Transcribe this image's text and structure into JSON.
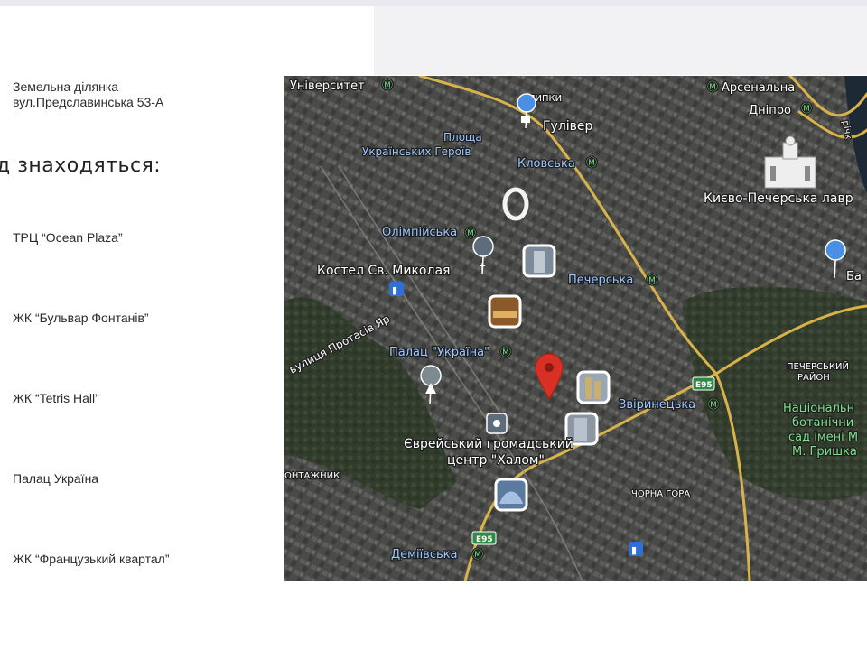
{
  "sidebar": {
    "land_line1": "Земельна ділянка",
    "land_line2": "вул.Предславинська 53-А",
    "heading": "д знаходяться:",
    "items": [
      "ТРЦ “Ocean Plaza”",
      "ЖК “Бульвар Фонтанів”",
      "ЖК “Tetris Hall”",
      "Палац Україна",
      "ЖК “Французький квартал”"
    ]
  },
  "map": {
    "labels": {
      "universytet": "Університет",
      "lypky": "ЛИПКИ",
      "arsenalna": "Арсенальна",
      "dnipro": "Дніпро",
      "ploshcha1": "Площа",
      "ploshcha2": "Українських Героїв",
      "hulliver": "Гулівер",
      "klovska": "Кловська",
      "lavra": "Києво-Печерська лавр",
      "olimpiiska": "Олімпійська",
      "kostel": "Костел Св. Миколая",
      "pecherska": "Печерська",
      "protasiv": "вулиця Протасів Яр",
      "palats": "Палац \"Україна\"",
      "pechersky1": "ПЕЧЕРСЬКИЙ",
      "pechersky2": "РАЙОН",
      "e95a": "E95",
      "zvirynetska": "Звіринецька",
      "botanic1": "Національн",
      "botanic2": "ботанічни",
      "botanic3": "сад імені М",
      "botanic4": "М. Гришка",
      "jewish1": "Єврейський громадський",
      "jewish2": "центр \"Халом\"",
      "montazhnyk": "ОНТАЖНИК",
      "chorna_hora": "ЧОРНА ГОРА",
      "e95b": "E95",
      "demiivska": "Деміївська",
      "river": "річк",
      "ba": "Ба"
    },
    "colors": {
      "road": "#d8b24a",
      "pin": "#d93025",
      "metro": "#3fb24f",
      "poi_blue": "#4a8fe6"
    }
  }
}
